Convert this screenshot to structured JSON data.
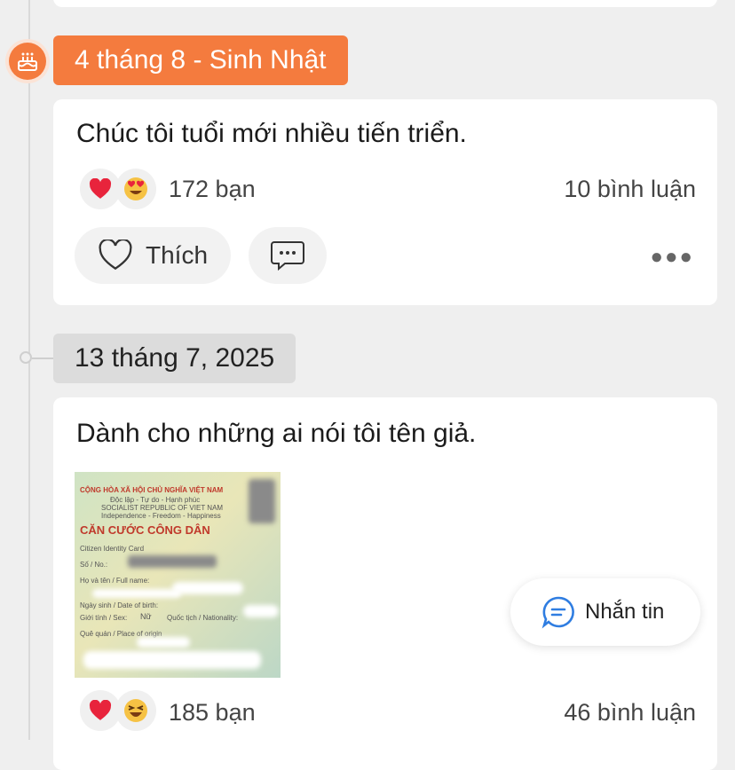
{
  "timeline": {
    "birthday_label": "4 tháng 8 - Sinh Nhật",
    "date_label": "13 tháng 7, 2025"
  },
  "posts": [
    {
      "text": "Chúc tôi tuổi mới nhiều tiến triển.",
      "reactions": [
        "heart",
        "heart-eyes"
      ],
      "reaction_count": "172 bạn",
      "comment_count": "10 bình luận",
      "like_label": "Thích"
    },
    {
      "text": "Dành cho những ai nói tôi tên giả.",
      "reactions": [
        "heart",
        "laughing"
      ],
      "reaction_count": "185 bạn",
      "comment_count": "46 bình luận"
    }
  ],
  "id_card": {
    "line1": "CỘNG HÒA XÃ HỘI CHỦ NGHĨA VIỆT NAM",
    "line2": "Độc lập - Tự do - Hạnh phúc",
    "line3": "SOCIALIST REPUBLIC OF VIET NAM",
    "line4": "Independence - Freedom - Happiness",
    "title": "CĂN CƯỚC CÔNG DÂN",
    "subtitle": "Citizen Identity Card",
    "no": "Số / No.:",
    "name": "Họ và tên / Full name:",
    "dob": "Ngày sinh / Date of birth:",
    "sex": "Giới tính / Sex:",
    "sex_value": "Nữ",
    "nationality": "Quốc tịch / Nationality:",
    "origin": "Quê quán / Place of origin"
  },
  "fab": {
    "label": "Nhắn tin"
  },
  "colors": {
    "accent": "#f47b3e",
    "background": "#efefef",
    "fab_icon": "#2f7de1"
  }
}
